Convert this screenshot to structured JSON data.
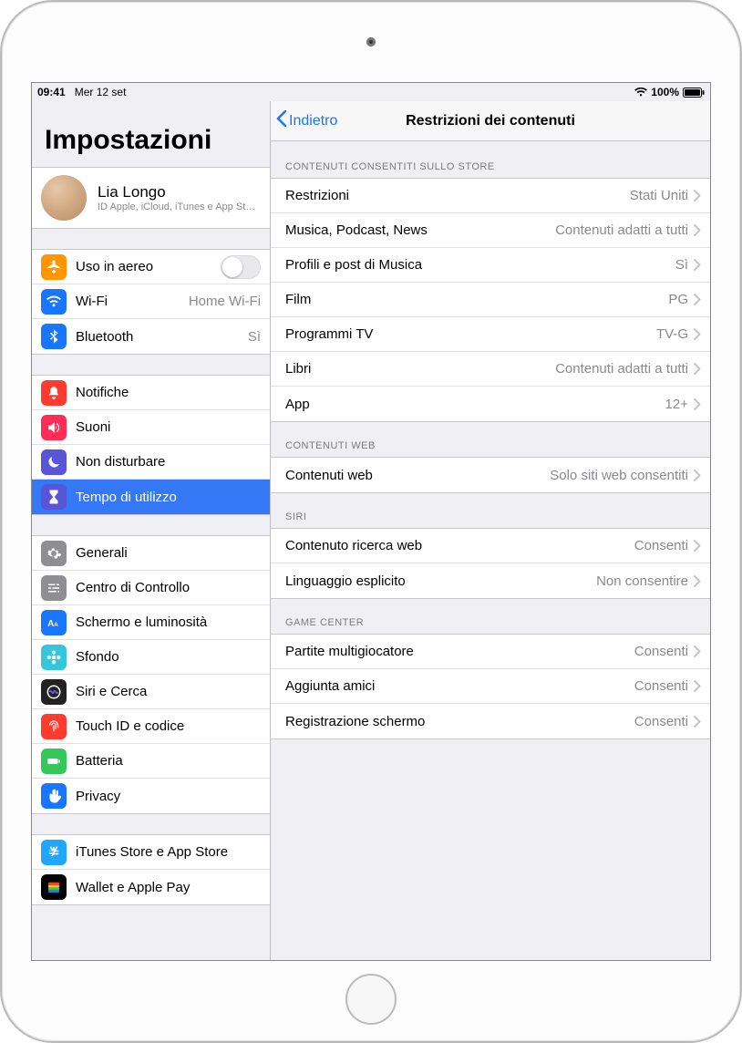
{
  "status": {
    "time": "09:41",
    "date": "Mer 12 set",
    "battery_pct": "100%"
  },
  "sidebar": {
    "title": "Impostazioni",
    "account": {
      "name": "Lia Longo",
      "sub": "ID Apple, iCloud, iTunes e App St…"
    },
    "groups": [
      {
        "rows": [
          {
            "icon": "airplane",
            "color": "#ff9500",
            "label": "Uso in aereo",
            "control": "toggle-off"
          },
          {
            "icon": "wifi",
            "color": "#1976ff",
            "label": "Wi-Fi",
            "value": "Home Wi-Fi"
          },
          {
            "icon": "bluetooth",
            "color": "#1976ff",
            "label": "Bluetooth",
            "value": "Sì"
          }
        ]
      },
      {
        "rows": [
          {
            "icon": "bell",
            "color": "#ff3b30",
            "label": "Notifiche"
          },
          {
            "icon": "speaker",
            "color": "#ff2d55",
            "label": "Suoni"
          },
          {
            "icon": "moon",
            "color": "#5856d6",
            "label": "Non disturbare"
          },
          {
            "icon": "hourglass",
            "color": "#5856d6",
            "label": "Tempo di utilizzo",
            "selected": true
          }
        ]
      },
      {
        "rows": [
          {
            "icon": "gear",
            "color": "#8e8e93",
            "label": "Generali"
          },
          {
            "icon": "sliders",
            "color": "#8e8e93",
            "label": "Centro di Controllo"
          },
          {
            "icon": "textsize",
            "color": "#1976ff",
            "label": "Schermo e luminosità"
          },
          {
            "icon": "flower",
            "color": "#35c6dc",
            "label": "Sfondo"
          },
          {
            "icon": "siri",
            "color": "#222",
            "label": "Siri e Cerca"
          },
          {
            "icon": "fingerprint",
            "color": "#ff3b30",
            "label": "Touch ID e codice"
          },
          {
            "icon": "battery",
            "color": "#34c759",
            "label": "Batteria"
          },
          {
            "icon": "hand",
            "color": "#1976ff",
            "label": "Privacy"
          }
        ]
      },
      {
        "rows": [
          {
            "icon": "appstore",
            "color": "#1ea7fd",
            "label": "iTunes Store e App Store"
          },
          {
            "icon": "wallet",
            "color": "#000",
            "label": "Wallet e Apple Pay"
          }
        ]
      }
    ]
  },
  "detail": {
    "back_label": "Indietro",
    "title": "Restrizioni dei contenuti",
    "sections": [
      {
        "header": "CONTENUTI CONSENTITI SULLO STORE",
        "rows": [
          {
            "label": "Restrizioni",
            "value": "Stati Uniti"
          },
          {
            "label": "Musica, Podcast, News",
            "value": "Contenuti adatti a tutti"
          },
          {
            "label": "Profili e post di Musica",
            "value": "Sì"
          },
          {
            "label": "Film",
            "value": "PG"
          },
          {
            "label": "Programmi TV",
            "value": "TV-G"
          },
          {
            "label": "Libri",
            "value": "Contenuti adatti a tutti"
          },
          {
            "label": "App",
            "value": "12+"
          }
        ]
      },
      {
        "header": "CONTENUTI WEB",
        "rows": [
          {
            "label": "Contenuti web",
            "value": "Solo siti web consentiti"
          }
        ]
      },
      {
        "header": "SIRI",
        "rows": [
          {
            "label": "Contenuto ricerca web",
            "value": "Consenti"
          },
          {
            "label": "Linguaggio esplicito",
            "value": "Non consentire"
          }
        ]
      },
      {
        "header": "GAME CENTER",
        "rows": [
          {
            "label": "Partite multigiocatore",
            "value": "Consenti"
          },
          {
            "label": "Aggiunta amici",
            "value": "Consenti"
          },
          {
            "label": "Registrazione schermo",
            "value": "Consenti"
          }
        ]
      }
    ]
  }
}
